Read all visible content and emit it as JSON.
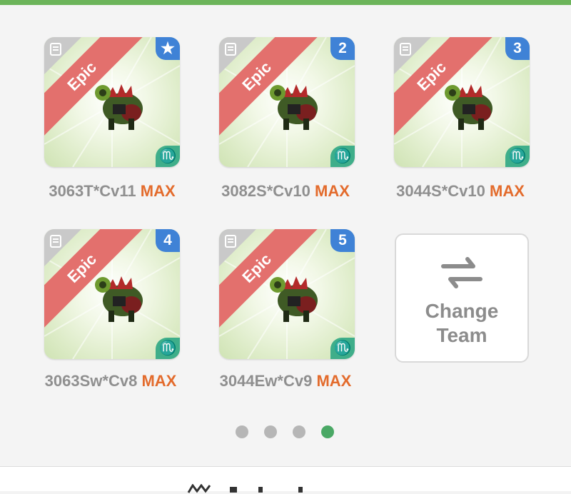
{
  "team": {
    "cards": [
      {
        "rarity": "Epic",
        "slot_badge": "★",
        "zodiac_icon": "scorpio-icon",
        "name": "3063T*Cv11",
        "level": "MAX"
      },
      {
        "rarity": "Epic",
        "slot_badge": "2",
        "zodiac_icon": "scorpio-icon",
        "name": "3082S*Cv10",
        "level": "MAX"
      },
      {
        "rarity": "Epic",
        "slot_badge": "3",
        "zodiac_icon": "scorpio-icon",
        "name": "3044S*Cv10",
        "level": "MAX"
      },
      {
        "rarity": "Epic",
        "slot_badge": "4",
        "zodiac_icon": "scorpio-icon",
        "name": "3063Sw*Cv8",
        "level": "MAX"
      },
      {
        "rarity": "Epic",
        "slot_badge": "5",
        "zodiac_icon": "scorpio-icon",
        "name": "3044Ew*Cv9",
        "level": "MAX"
      }
    ],
    "zodiac_symbol": "♏",
    "change_team_label_line1": "Change",
    "change_team_label_line2": "Team"
  },
  "pagination": {
    "total": 4,
    "active_index": 3
  },
  "colors": {
    "accent_green": "#6cb45a",
    "epic_ribbon": "#e3706d",
    "slot_badge_blue": "#3f82d6",
    "zodiac_teal": "#3fae8a",
    "max_orange": "#e36b2c",
    "dot_active": "#4aa865",
    "dot_inactive": "#b6b6b6"
  }
}
